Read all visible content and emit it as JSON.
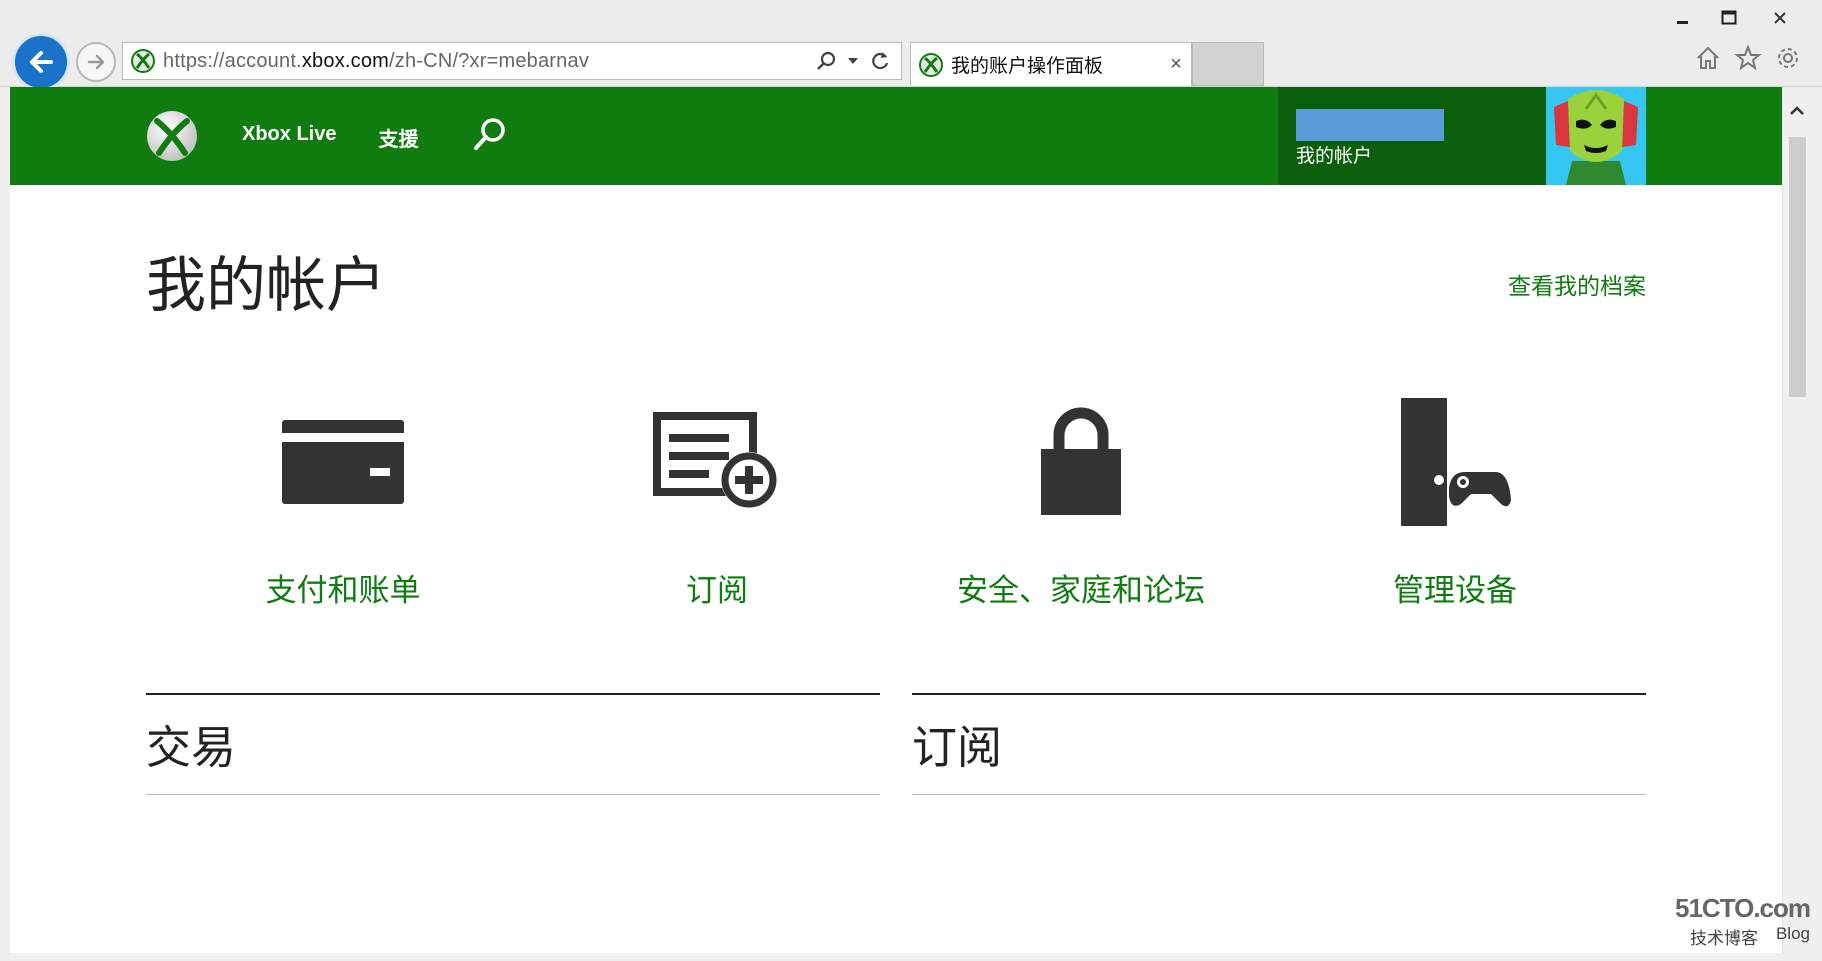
{
  "browser": {
    "url_prefix": "https://account.",
    "url_domain": "xbox.com",
    "url_suffix": "/zh-CN/?xr=mebarnav",
    "tab_title": "我的账户操作面板",
    "tab_close": "×"
  },
  "header": {
    "nav": [
      "Xbox Live",
      "支援"
    ],
    "account_label": "我的帐户",
    "accent_color": "#107c10"
  },
  "main": {
    "title": "我的帐户",
    "profile_link": "查看我的档案",
    "tiles": [
      {
        "label": "支付和账单",
        "icon": "credit-card-icon"
      },
      {
        "label": "订阅",
        "icon": "subscription-add-icon"
      },
      {
        "label": "安全、家庭和论坛",
        "icon": "lock-icon"
      },
      {
        "label": "管理设备",
        "icon": "console-controller-icon"
      }
    ],
    "sections": [
      {
        "title": "交易"
      },
      {
        "title": "订阅"
      }
    ]
  },
  "watermark": {
    "site": "51CTO.com",
    "line1": "技术博客",
    "line2": "Blog"
  }
}
